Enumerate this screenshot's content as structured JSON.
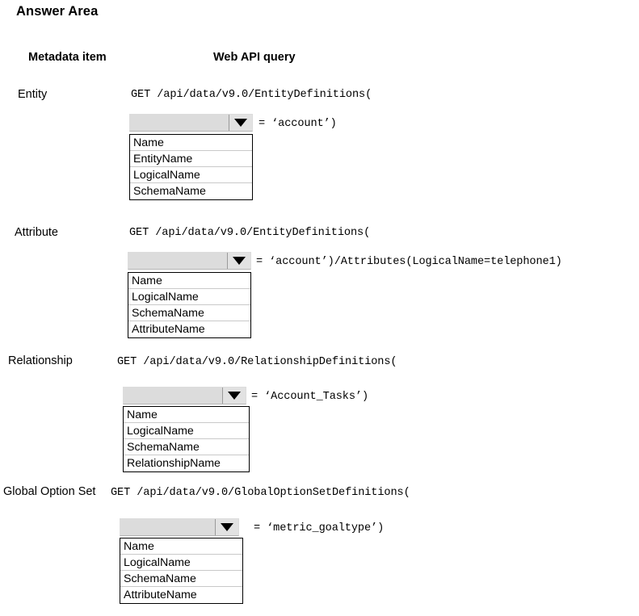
{
  "page": {
    "title": "Answer Area"
  },
  "headers": {
    "metadata_item": "Metadata item",
    "web_api_query": "Web API query"
  },
  "icons": {
    "dropdown_arrow": "chevron-down-icon"
  },
  "rows": [
    {
      "label": "Entity",
      "query_prefix": "GET /api/data/v9.0/EntityDefinitions(",
      "dropdown": {
        "value": "",
        "placeholder": "",
        "options": [
          "Name",
          "EntityName",
          "LogicalName",
          "SchemaName"
        ]
      },
      "query_suffix": "= ‘account’)"
    },
    {
      "label": "Attribute",
      "query_prefix": "GET /api/data/v9.0/EntityDefinitions(",
      "dropdown": {
        "value": "",
        "placeholder": "",
        "options": [
          "Name",
          "LogicalName",
          "SchemaName",
          "AttributeName"
        ]
      },
      "query_suffix": "= ‘account’)/Attributes(LogicalName=telephone1)"
    },
    {
      "label": "Relationship",
      "query_prefix": "GET /api/data/v9.0/RelationshipDefinitions(",
      "dropdown": {
        "value": "",
        "placeholder": "",
        "options": [
          "Name",
          "LogicalName",
          "SchemaName",
          "RelationshipName"
        ]
      },
      "query_suffix": "= ‘Account_Tasks’)"
    },
    {
      "label": "Global Option Set",
      "query_prefix": "GET /api/data/v9.0/GlobalOptionSetDefinitions(",
      "dropdown": {
        "value": "",
        "placeholder": "",
        "options": [
          "Name",
          "LogicalName",
          "SchemaName",
          "AttributeName"
        ]
      },
      "query_suffix": "= ‘metric_goaltype’)"
    }
  ],
  "colors": {
    "dropdown_bg": "#dcdcdc",
    "dropdown_button_bg": "#e2e2e2",
    "list_border": "#000000",
    "list_separator": "#c9c9c9",
    "text": "#000000",
    "background": "#ffffff"
  }
}
